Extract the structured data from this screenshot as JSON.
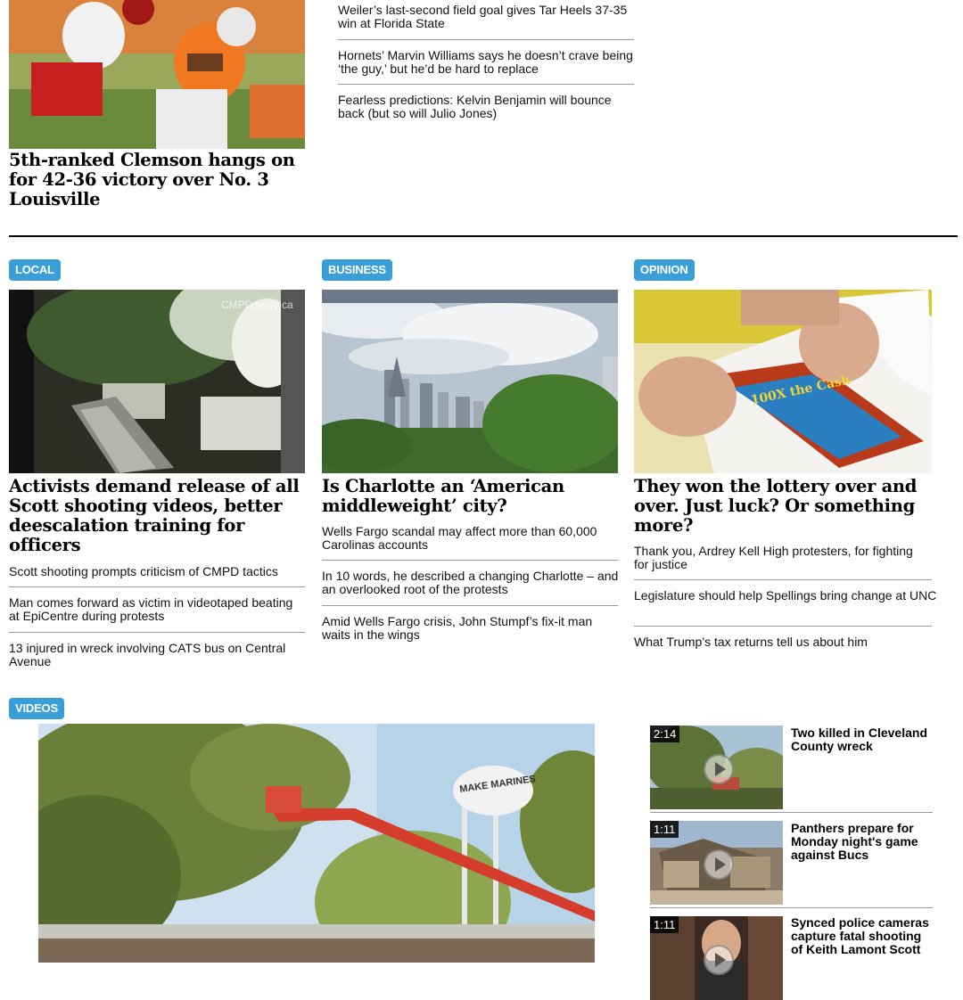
{
  "top": {
    "lead_headline": "5th-ranked Clemson hangs on for 42-36 victory over No. 3 Louisville",
    "links": [
      "Weiler’s last-second field goal gives Tar Heels 37-35 win at Florida State",
      "Hornets’ Marvin Williams says he doesn’t crave being ‘the guy,’ but he’d be hard to replace",
      "Fearless predictions: Kelvin Benjamin will bounce back (but so will Julio Jones)"
    ]
  },
  "sections": [
    {
      "tag": "LOCAL",
      "photo_caption": "CMPD body ca",
      "headline": "Activists demand release of all Scott shooting videos, better deescalation training for officers",
      "links": [
        "Scott shooting prompts criticism of CMPD tactics",
        "Man comes forward as victim in videotaped beating at EpiCentre during protests",
        "13 injured in wreck involving CATS bus on Central Avenue"
      ]
    },
    {
      "tag": "BUSINESS",
      "headline": "Is Charlotte an ‘American middleweight’ city?",
      "links": [
        "Wells Fargo scandal may affect more than 60,000 Carolinas accounts",
        "In 10 words, he described a changing Charlotte – and an overlooked root of the protests",
        "Amid Wells Fargo crisis, John Stumpf’s fix-it man waits in the wings"
      ]
    },
    {
      "tag": "OPINION",
      "photo_text": "100X the Cash",
      "headline": "They won the lottery over and over. Just luck? Or something more?",
      "links": [
        "Thank you, Ardrey Kell High protesters, for fighting for justice",
        "Legislature should help Spellings bring change at UNC",
        "What Trump’s tax returns tell us about him"
      ]
    }
  ],
  "videos": {
    "tag": "VIDEOS",
    "main_photo_text": "MAKE MARINES",
    "items": [
      {
        "duration": "2:14",
        "title": "Two killed in Cleveland County wreck"
      },
      {
        "duration": "1:11",
        "title": "Panthers prepare for Monday night's game against Bucs"
      },
      {
        "duration": "1:11",
        "title": "Synced police cameras capture fatal shooting of Keith Lamont Scott"
      }
    ]
  },
  "colors": {
    "tag_bg": "#3a9fd8",
    "rule": "#999999",
    "section_rule": "#000000"
  }
}
